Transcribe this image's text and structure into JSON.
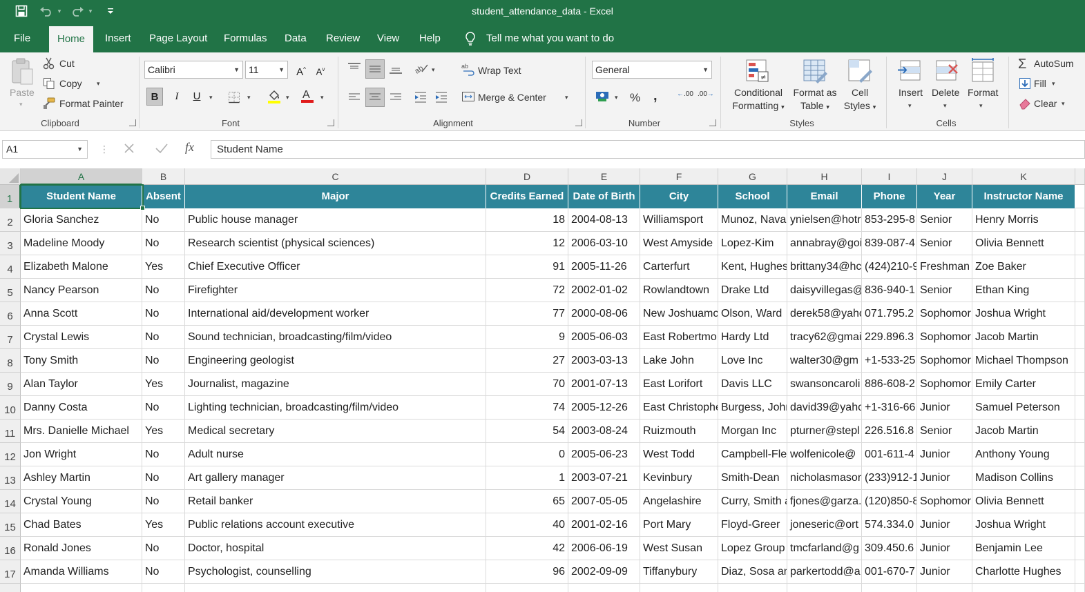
{
  "window": {
    "title": "student_attendance_data  -  Excel",
    "save_icon": "save-icon",
    "undo_icon": "undo-icon",
    "redo_icon": "redo-icon",
    "customize_icon": "customize-qat-icon"
  },
  "tabs": [
    "File",
    "Home",
    "Insert",
    "Page Layout",
    "Formulas",
    "Data",
    "Review",
    "View",
    "Help"
  ],
  "active_tab": "Home",
  "tell_me": "Tell me what you want to do",
  "ribbon": {
    "clipboard": {
      "label": "Clipboard",
      "paste": "Paste",
      "cut": "Cut",
      "copy": "Copy",
      "format_painter": "Format Painter"
    },
    "font": {
      "label": "Font",
      "font_name": "Calibri",
      "font_size": "11",
      "bold": "B",
      "italic": "I",
      "underline": "U",
      "increase": "A",
      "decrease": "A",
      "font_color": "#e01b1b",
      "highlight_color": "#ffff00"
    },
    "alignment": {
      "label": "Alignment",
      "wrap_text": "Wrap Text",
      "merge_center": "Merge & Center"
    },
    "number": {
      "label": "Number",
      "format": "General",
      "percent": "%",
      "comma": ",",
      "inc_decimal": ".00",
      "dec_decimal": ".00"
    },
    "styles": {
      "label": "Styles",
      "conditional": [
        "Conditional",
        "Formatting"
      ],
      "format_table": [
        "Format as",
        "Table"
      ],
      "cell_styles": [
        "Cell",
        "Styles"
      ]
    },
    "cells": {
      "label": "Cells",
      "insert": "Insert",
      "delete": "Delete",
      "format": "Format"
    },
    "editing": {
      "autosum": "AutoSum",
      "fill": "Fill",
      "clear": "Clear"
    }
  },
  "formula_bar": {
    "name_box": "A1",
    "content": "Student Name",
    "fx": "fx"
  },
  "grid": {
    "columns": [
      "A",
      "B",
      "C",
      "D",
      "E",
      "F",
      "G",
      "H",
      "I",
      "J",
      "K"
    ],
    "header_color": "#2e8599",
    "headers": [
      "Student Name",
      "Absent",
      "Major",
      "Credits Earned",
      "Date of Birth",
      "City",
      "School",
      "Email",
      "Phone",
      "Year",
      "Instructor Name"
    ],
    "row_numbers": [
      "1",
      "2",
      "3",
      "4",
      "5",
      "6",
      "7",
      "8",
      "9",
      "10",
      "11",
      "12",
      "13",
      "14",
      "15",
      "16",
      "17"
    ],
    "rows": [
      [
        "Gloria Sanchez",
        "No",
        "Public house manager",
        "18",
        "2004-08-13",
        "Williamsport",
        "Munoz, Nava",
        "ynielsen@hotr",
        "853-295-8",
        "Senior",
        "Henry Morris"
      ],
      [
        "Madeline Moody",
        "No",
        "Research scientist (physical sciences)",
        "12",
        "2006-03-10",
        "West Amyside",
        "Lopez-Kim",
        "annabray@goi",
        "839-087-4",
        "Senior",
        "Olivia Bennett"
      ],
      [
        "Elizabeth Malone",
        "Yes",
        "Chief Executive Officer",
        "91",
        "2005-11-26",
        "Carterfurt",
        "Kent, Hughes",
        "brittany34@hc",
        "(424)210-9",
        "Freshman",
        "Zoe Baker"
      ],
      [
        "Nancy Pearson",
        "No",
        "Firefighter",
        "72",
        "2002-01-02",
        "Rowlandtown",
        "Drake Ltd",
        "daisyvillegas@",
        "836-940-1",
        "Senior",
        "Ethan King"
      ],
      [
        "Anna Scott",
        "No",
        "International aid/development worker",
        "77",
        "2000-08-06",
        "New Joshuamc",
        "Olson, Ward",
        "derek58@yahc",
        "071.795.2",
        "Sophomor",
        "Joshua Wright"
      ],
      [
        "Crystal Lewis",
        "No",
        "Sound technician, broadcasting/film/video",
        "9",
        "2005-06-03",
        "East Robertmo",
        "Hardy Ltd",
        "tracy62@gmai",
        "229.896.3",
        "Sophomor",
        "Jacob Martin"
      ],
      [
        "Tony Smith",
        "No",
        "Engineering geologist",
        "27",
        "2003-03-13",
        "Lake John",
        "Love Inc",
        "walter30@gm",
        "+1-533-25",
        "Sophomor",
        "Michael Thompson"
      ],
      [
        "Alan Taylor",
        "Yes",
        "Journalist, magazine",
        "70",
        "2001-07-13",
        "East Lorifort",
        "Davis LLC",
        "swansoncaroli",
        "886-608-2",
        "Sophomor",
        "Emily Carter"
      ],
      [
        "Danny Costa",
        "No",
        "Lighting technician, broadcasting/film/video",
        "74",
        "2005-12-26",
        "East Christophe",
        "Burgess, John",
        "david39@yahc",
        "+1-316-66",
        "Junior",
        "Samuel Peterson"
      ],
      [
        "Mrs. Danielle Michael",
        "Yes",
        "Medical secretary",
        "54",
        "2003-08-24",
        "Ruizmouth",
        "Morgan Inc",
        "pturner@stepl",
        "226.516.8",
        "Senior",
        "Jacob Martin"
      ],
      [
        "Jon Wright",
        "No",
        "Adult nurse",
        "0",
        "2005-06-23",
        "West Todd",
        "Campbell-Fle",
        "wolfenicole@",
        "001-611-4",
        "Junior",
        "Anthony Young"
      ],
      [
        "Ashley Martin",
        "No",
        "Art gallery manager",
        "1",
        "2003-07-21",
        "Kevinbury",
        "Smith-Dean",
        "nicholasmasor",
        "(233)912-1",
        "Junior",
        "Madison Collins"
      ],
      [
        "Crystal Young",
        "No",
        "Retail banker",
        "65",
        "2007-05-05",
        "Angelashire",
        "Curry, Smith a",
        "fjones@garza.",
        "(120)850-8",
        "Sophomor",
        "Olivia Bennett"
      ],
      [
        "Chad Bates",
        "Yes",
        "Public relations account executive",
        "40",
        "2001-02-16",
        "Port Mary",
        "Floyd-Greer",
        "joneseric@ort",
        "574.334.0",
        "Junior",
        "Joshua Wright"
      ],
      [
        "Ronald Jones",
        "No",
        "Doctor, hospital",
        "42",
        "2006-06-19",
        "West Susan",
        "Lopez Group",
        "tmcfarland@g",
        "309.450.6",
        "Junior",
        "Benjamin Lee"
      ],
      [
        "Amanda Williams",
        "No",
        "Psychologist, counselling",
        "96",
        "2002-09-09",
        "Tiffanybury",
        "Diaz, Sosa an",
        "parkertodd@a",
        "001-670-7",
        "Junior",
        "Charlotte Hughes"
      ]
    ]
  }
}
